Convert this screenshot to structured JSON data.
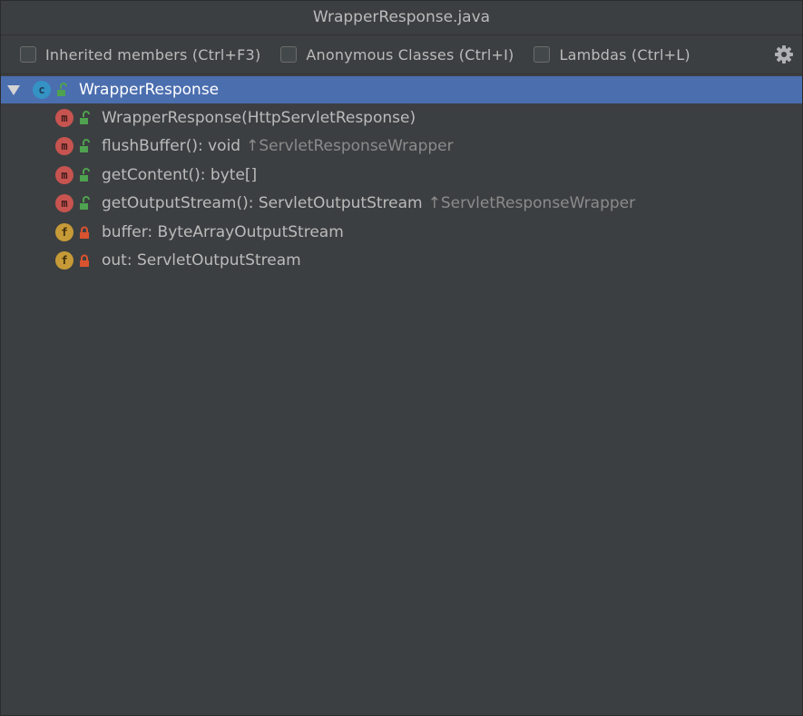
{
  "window": {
    "title": "WrapperResponse.java"
  },
  "toolbar": {
    "checkboxes": [
      {
        "label": "Inherited members (Ctrl+F3)",
        "checked": false
      },
      {
        "label": "Anonymous Classes (Ctrl+I)",
        "checked": false
      },
      {
        "label": "Lambdas (Ctrl+L)",
        "checked": false
      }
    ],
    "settings_icon": "gear-icon"
  },
  "tree": {
    "root": {
      "kind_letter": "c",
      "name": "WrapperResponse",
      "expanded": true,
      "selected": true
    },
    "members": [
      {
        "kind_letter": "m",
        "visibility": "public",
        "name": "WrapperResponse(HttpServletResponse)",
        "hint": ""
      },
      {
        "kind_letter": "m",
        "visibility": "public",
        "name": "flushBuffer(): void",
        "hint": "↑ServletResponseWrapper"
      },
      {
        "kind_letter": "m",
        "visibility": "public",
        "name": "getContent(): byte[]",
        "hint": ""
      },
      {
        "kind_letter": "m",
        "visibility": "public",
        "name": "getOutputStream(): ServletOutputStream",
        "hint": "↑ServletResponseWrapper"
      },
      {
        "kind_letter": "f",
        "visibility": "private",
        "name": "buffer: ByteArrayOutputStream",
        "hint": ""
      },
      {
        "kind_letter": "f",
        "visibility": "private",
        "name": "out: ServletOutputStream",
        "hint": ""
      }
    ]
  },
  "colors": {
    "background": "#3c3f41",
    "selection": "#4b6eaf",
    "class_icon": "#3592c4",
    "method_icon": "#c75450",
    "field_icon": "#c69a37",
    "public_lock": "#4fa24f",
    "private_lock": "#d9532f",
    "hint_text": "#8b8b8b"
  }
}
